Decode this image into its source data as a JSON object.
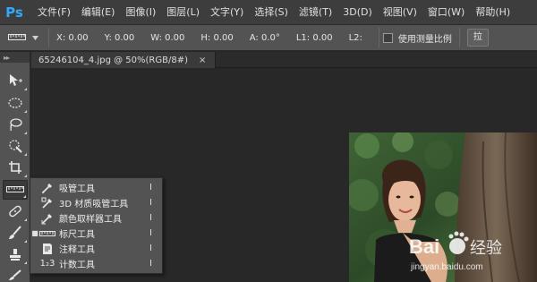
{
  "app": {
    "logo": "Ps",
    "menus": [
      "文件(F)",
      "编辑(E)",
      "图像(I)",
      "图层(L)",
      "文字(Y)",
      "选择(S)",
      "滤镜(T)",
      "3D(D)",
      "视图(V)",
      "窗口(W)",
      "帮助(H)"
    ]
  },
  "options": {
    "x": "X: 0.00",
    "y": "Y: 0.00",
    "w": "W: 0.00",
    "h": "H: 0.00",
    "a": "A: 0.0°",
    "l1": "L1: 0.00",
    "l2": "L2:",
    "use_measurement_scale": "使用测量比例",
    "straighten_label": "拉"
  },
  "toolbar": {
    "collapse_glyph": "▸▸",
    "tools": [
      "move-tool",
      "elliptical-marquee-tool",
      "lasso-tool",
      "quick-selection-tool",
      "crop-tool",
      "ruler-tool",
      "healing-brush-tool",
      "brush-tool",
      "clone-stamp-tool",
      "history-brush-tool"
    ]
  },
  "document": {
    "tab_label": "65246104_4.jpg @ 50%(RGB/8#)",
    "close_glyph": "×"
  },
  "flyout": {
    "items": [
      {
        "label": "吸管工具",
        "shortcut": "I",
        "icon": "eyedropper-icon",
        "active": false
      },
      {
        "label": "3D 材质吸管工具",
        "shortcut": "I",
        "icon": "3d-material-eyedropper-icon",
        "active": false
      },
      {
        "label": "颜色取样器工具",
        "shortcut": "I",
        "icon": "color-sampler-icon",
        "active": false
      },
      {
        "label": "标尺工具",
        "shortcut": "I",
        "icon": "ruler-icon",
        "active": true
      },
      {
        "label": "注释工具",
        "shortcut": "I",
        "icon": "note-icon",
        "active": false
      },
      {
        "label": "计数工具",
        "shortcut": "I",
        "icon": "count-icon",
        "active": false
      }
    ],
    "bullet": "■",
    "count_icon_text": "1₂3"
  },
  "watermark": {
    "brand_left": "Bai",
    "brand_right": "经验",
    "url": "jingyan.baidu.com"
  },
  "colors": {
    "menubar": "#3d3d3d",
    "options_bar": "#535353",
    "canvas_bg": "#282828",
    "ps_blue": "#31a8ff"
  }
}
